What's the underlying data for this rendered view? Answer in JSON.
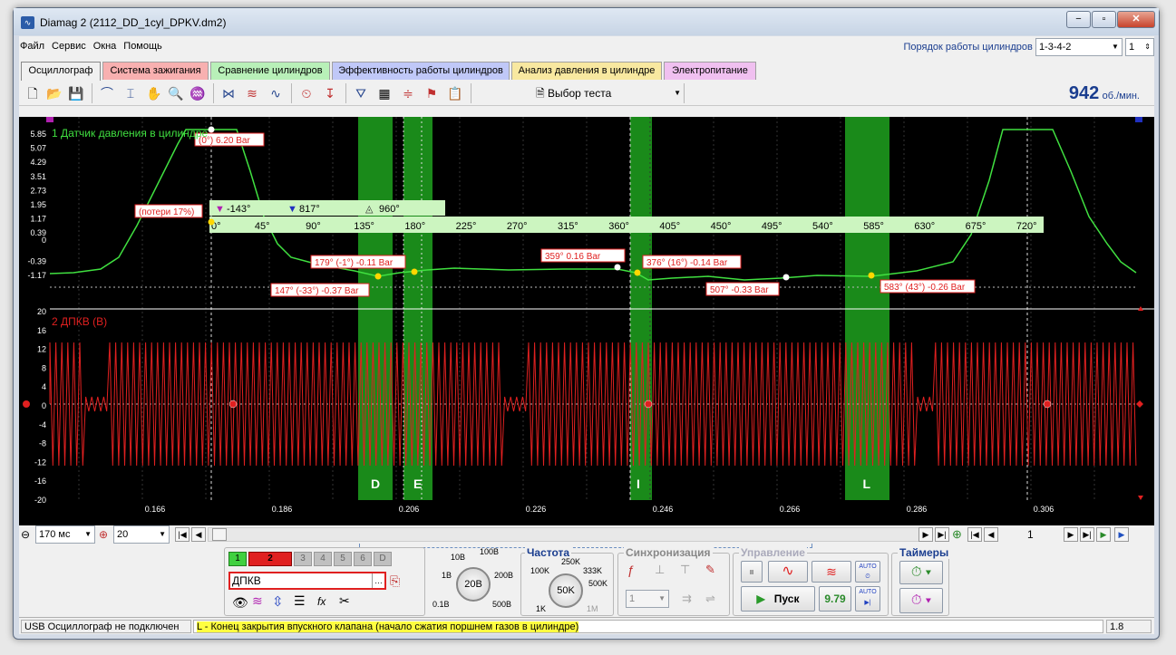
{
  "window": {
    "title": "Diamag 2 (2112_DD_1cyl_DPKV.dm2)",
    "minimize": "−",
    "maximize": "▫",
    "close": "✕"
  },
  "menu": [
    "Файл",
    "Сервис",
    "Окна",
    "Помощь"
  ],
  "cylinder_order": {
    "label": "Порядок работы цилиндров",
    "value": "1-3-4-2",
    "cyl": "1"
  },
  "tabs": [
    {
      "label": "Осциллограф",
      "color": "#f0f0f0"
    },
    {
      "label": "Система зажигания",
      "color": "#f8b0b0"
    },
    {
      "label": "Сравнение цилиндров",
      "color": "#b8f0b8"
    },
    {
      "label": "Эффективность работы цилиндров",
      "color": "#c0c8f8"
    },
    {
      "label": "Анализ давления в цилиндре",
      "color": "#f8e8a0"
    },
    {
      "label": "Электропитание",
      "color": "#f0c0f0"
    }
  ],
  "toolbar": {
    "test_select": "Выбор теста",
    "rpm_value": "942",
    "rpm_unit": "об./мин."
  },
  "scope": {
    "channel1_label": "1 Датчик давления в цилиндре",
    "channel2_label": "2 ДПКВ (B)",
    "ch1_ticks": [
      "5.85",
      "5.07",
      "4.29",
      "3.51",
      "2.73",
      "1.95",
      "1.17",
      "0.39",
      "0",
      "-0.39",
      "-1.17"
    ],
    "ch2_ticks": [
      "20",
      "16",
      "12",
      "8",
      "4",
      "0",
      "-4",
      "-8",
      "-12",
      "-16",
      "-20"
    ],
    "x_ticks": [
      "0.166",
      "0.186",
      "0.206",
      "0.226",
      "0.246",
      "0.266",
      "0.286",
      "0.306"
    ],
    "angle_ticks": [
      "0°",
      "45°",
      "90°",
      "135°",
      "180°",
      "225°",
      "270°",
      "315°",
      "360°",
      "405°",
      "450°",
      "495°",
      "540°",
      "585°",
      "630°",
      "675°",
      "720°"
    ],
    "markers": {
      "m1": "-143°",
      "m2": "817°",
      "m3": "960°"
    },
    "annotations": [
      {
        "text": "(0°) 6.20 Bar"
      },
      {
        "text": "(потери 17%)"
      },
      {
        "text": "179° (-1°) -0.11 Bar"
      },
      {
        "text": "147° (-33°) -0.37 Bar"
      },
      {
        "text": "359° 0.16 Bar"
      },
      {
        "text": "376° (16°) -0.14 Bar"
      },
      {
        "text": "507° -0.33 Bar"
      },
      {
        "text": "583° (43°) -0.26 Bar"
      }
    ],
    "zones": [
      {
        "letter": "D"
      },
      {
        "letter": "E"
      },
      {
        "letter": "I"
      },
      {
        "letter": "L"
      }
    ]
  },
  "timebase": {
    "value": "170 мс",
    "zoom": "20",
    "page": "1"
  },
  "channels": {
    "buttons": [
      "1",
      "2",
      "3",
      "4",
      "5",
      "6",
      "D"
    ],
    "sensor_name": "ДПКВ",
    "voltage_labels": [
      "10В",
      "100В",
      "1В",
      "200В",
      "0.1В",
      "500В"
    ],
    "voltage_value": "20В"
  },
  "frequency": {
    "title": "Частота",
    "labels": [
      "250K",
      "100K",
      "333K",
      "500K",
      "1K",
      "1M"
    ],
    "value": "50K"
  },
  "sync": {
    "title": "Синхронизация",
    "value": "1"
  },
  "control": {
    "title": "Управление",
    "start": "Пуск",
    "level": "9.79",
    "auto1": "AUTO",
    "auto2": "AUTO"
  },
  "timers": {
    "title": "Таймеры"
  },
  "status": {
    "usb": "USB Осциллограф не подключен",
    "hint": "L - Конец закрытия впускного клапана (начало сжатия поршнем газов в цилиндре)",
    "version": "1.8"
  }
}
